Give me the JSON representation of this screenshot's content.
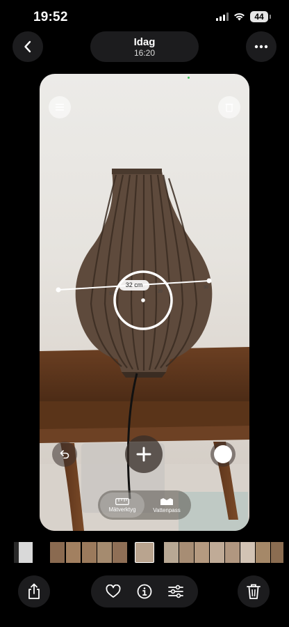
{
  "status_bar": {
    "time": "19:52",
    "battery": "44"
  },
  "header": {
    "title": "Idag",
    "subtitle": "16:20"
  },
  "measurement": {
    "value_label": "32 cm",
    "tick_left": "10",
    "tick_mid": "20",
    "tick_right": "30"
  },
  "measure_modes": [
    {
      "label": "Mätverktyg",
      "icon": "ruler-icon",
      "active": true
    },
    {
      "label": "Vattenpass",
      "icon": "level-icon",
      "active": false
    }
  ],
  "icons": {
    "back": "chevron-left-icon",
    "more": "ellipsis-icon",
    "undo": "undo-icon",
    "add": "plus-icon",
    "share": "share-icon",
    "favorite": "heart-icon",
    "info": "info-icon",
    "adjust": "sliders-icon",
    "delete": "trash-icon"
  },
  "colors": {
    "background": "#000000",
    "button": "#1c1c1e",
    "accent_dot": "#3fc25b"
  }
}
